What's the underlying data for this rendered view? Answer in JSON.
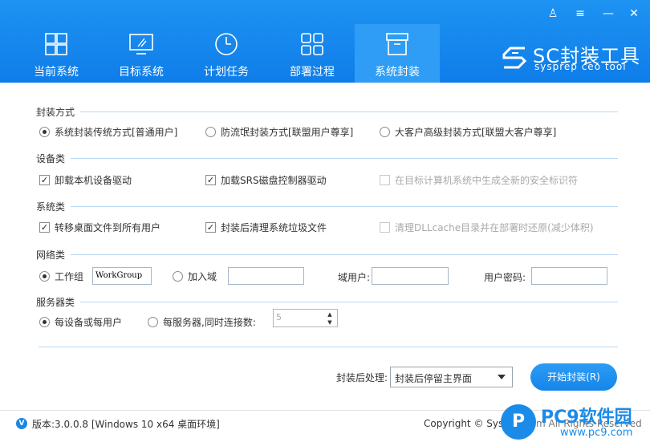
{
  "window": {
    "controls": {
      "user": "♙",
      "menu": "≡",
      "minimize": "—",
      "close": "✕"
    }
  },
  "tabs": [
    {
      "label": "当前系统",
      "icon": "windows-icon"
    },
    {
      "label": "目标系统",
      "icon": "monitor-icon"
    },
    {
      "label": "计划任务",
      "icon": "clock-icon"
    },
    {
      "label": "部署过程",
      "icon": "grid-icon"
    },
    {
      "label": "系统封装",
      "icon": "package-icon",
      "active": true
    }
  ],
  "logo": {
    "title": "SC封装工具",
    "subtitle": "sysprep ceo tool"
  },
  "sections": {
    "package_mode": {
      "title": "封装方式",
      "options": [
        {
          "label": "系统封装传统方式[普通用户]",
          "selected": true
        },
        {
          "label": "防流氓封装方式[联盟用户尊享]",
          "selected": false
        },
        {
          "label": "大客户高级封装方式[联盟大客户尊享]",
          "selected": false
        }
      ]
    },
    "devices": {
      "title": "设备类",
      "options": [
        {
          "label": "卸载本机设备驱动",
          "checked": true,
          "enabled": true
        },
        {
          "label": "加载SRS磁盘控制器驱动",
          "checked": true,
          "enabled": true
        },
        {
          "label": "在目标计算机系统中生成全新的安全标识符",
          "checked": false,
          "enabled": false
        }
      ]
    },
    "system": {
      "title": "系统类",
      "options": [
        {
          "label": "转移桌面文件到所有用户",
          "checked": true,
          "enabled": true
        },
        {
          "label": "封装后清理系统垃圾文件",
          "checked": true,
          "enabled": true
        },
        {
          "label": "清理DLLcache目录并在部署时还原(减少体积)",
          "checked": false,
          "enabled": false
        }
      ]
    },
    "network": {
      "title": "网络类",
      "workgroup_label": "工作组",
      "workgroup_value": "WorkGroup",
      "domain_label": "加入域",
      "domain_value": "",
      "domain_user_label": "域用户:",
      "domain_user_value": "",
      "user_password_label": "用户密码:",
      "user_password_value": ""
    },
    "server": {
      "title": "服务器类",
      "per_device_label": "每设备或每用户",
      "per_server_label": "每服务器,同时连接数:",
      "connections": "5"
    }
  },
  "bottom": {
    "after_label": "封装后处理:",
    "after_value": "封装后停留主界面",
    "start_button": "开始封装(R)"
  },
  "footer": {
    "version": "版本:3.0.0.8 [Windows 10 x64 桌面环境]",
    "copyright": "Copyright © Sys",
    "copyright_tail": "m All Rights Reserved"
  },
  "watermark": {
    "badge": "P",
    "title": "PC9软件园",
    "url": "www.pc9.com"
  },
  "colors": {
    "header": "#1a87e8",
    "accent": "#2c9cf5"
  }
}
